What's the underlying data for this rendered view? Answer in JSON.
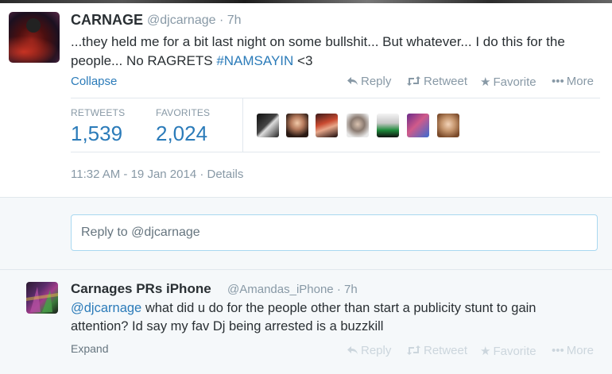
{
  "tweet": {
    "display_name": "CARNAGE",
    "handle": "@djcarnage",
    "time_ago": "· 7h",
    "text_before_hashtag": "...they held me for a bit last night on some bullshit... But whatever... I do this for the people... No RAGRETS ",
    "hashtag": "#NAMSAYIN",
    "text_after_hashtag": " <3",
    "collapse_label": "Collapse",
    "actions": {
      "reply": "Reply",
      "retweet": "Retweet",
      "favorite": "Favorite",
      "more": "More"
    },
    "stats": {
      "retweets_label": "RETWEETS",
      "retweets_value": "1,539",
      "favorites_label": "FAVORITES",
      "favorites_value": "2,024"
    },
    "timestamp": "11:32 AM - 19 Jan 2014",
    "details_link": "· Details"
  },
  "reply_box": {
    "placeholder": "Reply to @djcarnage"
  },
  "reply_tweet": {
    "display_name": "Carnages PRs iPhone",
    "handle": "@Amandas_iPhone",
    "time_ago": "· 7h",
    "mention": "@djcarnage",
    "text": " what did u do for the people other than start a publicity stunt to gain attention? Id say my fav Dj being arrested is a buzzkill",
    "expand_label": "Expand",
    "actions": {
      "reply": "Reply",
      "retweet": "Retweet",
      "favorite": "Favorite",
      "more": "More"
    }
  },
  "colors": {
    "link_blue": "#2b7bb9",
    "meta_gray": "#8899a6",
    "text_dark": "#292f33",
    "background_gray": "#f5f8fa"
  }
}
